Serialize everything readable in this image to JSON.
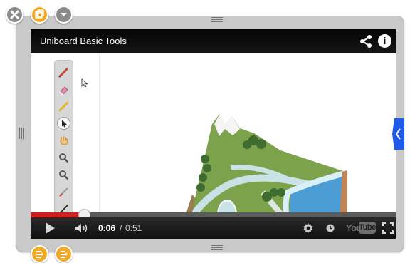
{
  "window": {
    "title": "Uniboard Basic Tools"
  },
  "video": {
    "title": "Uniboard Basic Tools",
    "current_time": "0:06",
    "time_separator": " / ",
    "total_time": "0:51",
    "progress": 0.146,
    "buffered": 1.0,
    "brand_word": "You",
    "brand_tube": "Tube"
  },
  "icons": {
    "top_left": [
      "close-icon",
      "duplicate-icon",
      "chevron-down-icon"
    ],
    "bottom_left": [
      "widget-menu-icon",
      "widget-menu-icon"
    ],
    "player": [
      "share-icon",
      "info-icon",
      "play-icon",
      "volume-icon",
      "gear-icon",
      "clock-icon",
      "fullscreen-icon"
    ],
    "palette": [
      "pen-icon",
      "eraser-icon",
      "marker-icon",
      "selector-icon",
      "hand-icon",
      "zoom-in-icon",
      "zoom-out-icon",
      "laser-pointer-icon",
      "line-icon"
    ]
  },
  "colors": {
    "frame": "#c9c9c9",
    "player_background": "#000000",
    "progress_red": "#cf1f1f",
    "accent_orange": "#f0aa25",
    "side_tab_blue": "#1f5be8"
  }
}
